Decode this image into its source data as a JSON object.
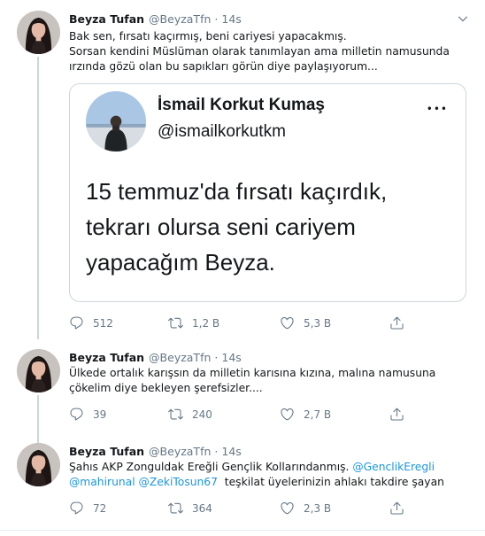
{
  "tweets": [
    {
      "name": "Beyza Tufan",
      "handle": "@BeyzaTfn",
      "dot": "·",
      "time": "14s",
      "text_lines": [
        "Bak sen, fırsatı kaçırmış, beni cariyesi yapacakmış.",
        "Sorsan kendini Müslüman olarak tanımlayan ama milletin namusunda",
        "ırzında gözü olan bu sapıkları görün diye paylaşıyorum..."
      ],
      "quote": {
        "name": "İsmail Korkut Kumaş",
        "handle": "@ismailkorkutkm",
        "more": "•••",
        "text_lines": [
          "15 temmuz'da fırsatı kaçırdık,",
          "tekrarı olursa seni cariyem",
          "yapacağım Beyza."
        ]
      },
      "replies": "512",
      "retweets": "1,2 B",
      "likes": "5,3 B"
    },
    {
      "name": "Beyza Tufan",
      "handle": "@BeyzaTfn",
      "dot": "·",
      "time": "14s",
      "text_lines": [
        "Ülkede ortalık karışsın da milletin karısına kızına, malına namusuna",
        "çökelim diye bekleyen şerefsizler...."
      ],
      "replies": "39",
      "retweets": "240",
      "likes": "2,7 B"
    },
    {
      "name": "Beyza Tufan",
      "handle": "@BeyzaTfn",
      "dot": "·",
      "time": "14s",
      "line1_text": "Şahıs AKP Zonguldak Ereğli Gençlik Kollarındanmış. ",
      "line1_link": "@GenclikEregli",
      "line2_link1": "@mahirunal",
      "line2_link2": "@ZekiTosun67",
      "line2_text": "  teşkilat üyelerinizin ahlakı takdire şayan",
      "replies": "72",
      "retweets": "364",
      "likes": "2,3 B"
    }
  ],
  "colors": {
    "text": "#14171a",
    "secondary": "#657786",
    "link": "#1b95e0",
    "border": "#ccd6dd",
    "divider": "#e6ecf0"
  },
  "icons": [
    "chevron-down-icon",
    "reply-icon",
    "retweet-icon",
    "like-icon",
    "share-icon",
    "more-icon"
  ]
}
